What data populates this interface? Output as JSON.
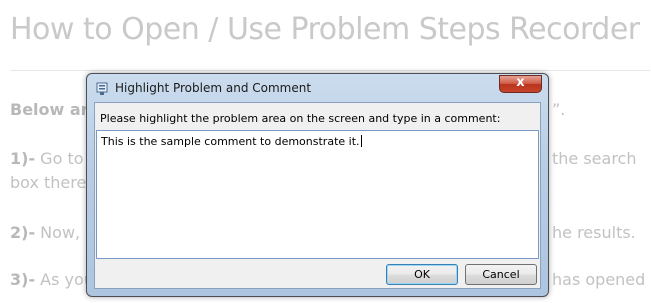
{
  "article": {
    "title": "How to Open / Use Problem Steps Recorder",
    "lines": [
      {
        "bold": "Below ar",
        "rest": "",
        "tail": "”."
      },
      {
        "bold": "1)-",
        "rest": " Go to t",
        "tail": "the search"
      },
      {
        "bold": "",
        "rest": "box there",
        "tail": ""
      },
      {
        "bold": "2)-",
        "rest": " Now, C",
        "tail": "he results."
      },
      {
        "bold": "3)-",
        "rest": " As you",
        "tail": "has opened"
      }
    ]
  },
  "dialog": {
    "title": "Highlight Problem and Comment",
    "close_label": "x",
    "instruction": "Please highlight the problem area on the screen and type in a comment:",
    "comment_value": "This is the sample comment to demonstrate it.",
    "ok_label": "OK",
    "cancel_label": "Cancel"
  }
}
